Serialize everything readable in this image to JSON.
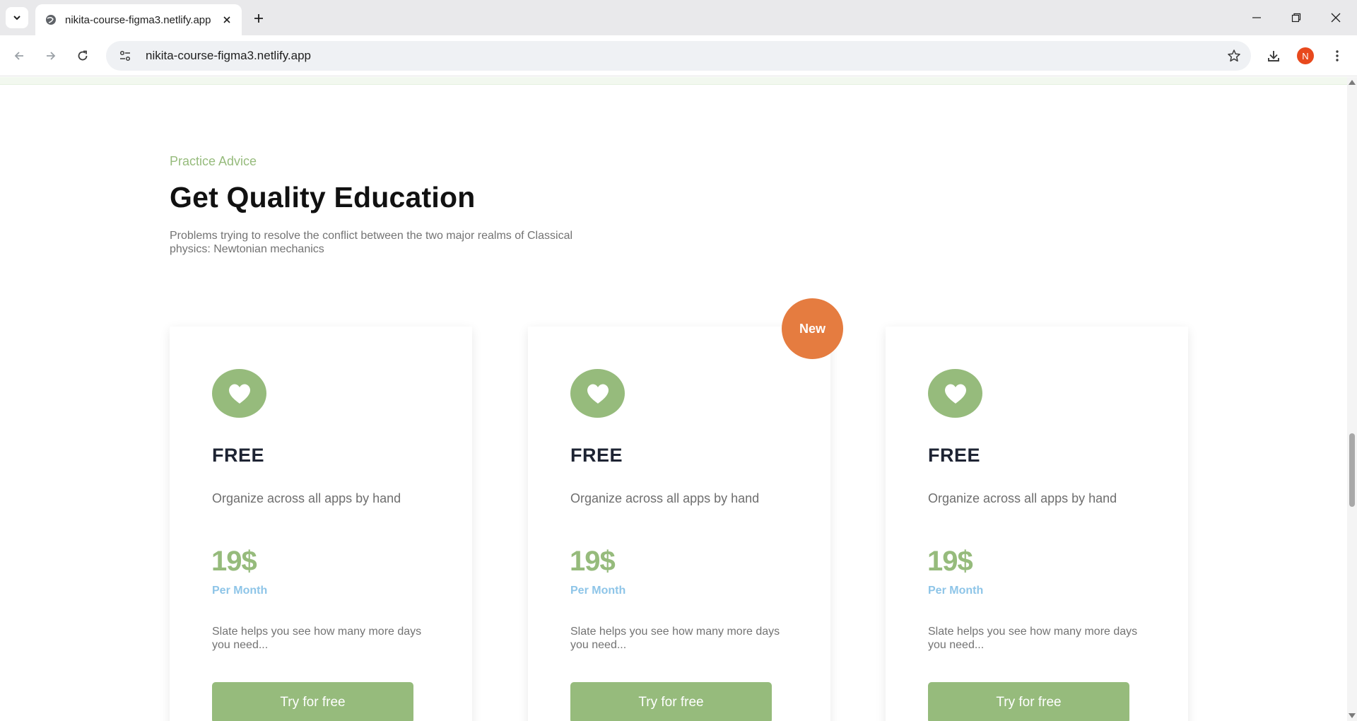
{
  "browser": {
    "tab_title": "nikita-course-figma3.netlify.app",
    "url": "nikita-course-figma3.netlify.app",
    "profile_initial": "N"
  },
  "section": {
    "eyebrow": "Practice Advice",
    "heading": "Get Quality Education",
    "subtext": "Problems trying to resolve the conflict between the two major realms of Classical physics: Newtonian mechanics"
  },
  "badge": "New",
  "cards": [
    {
      "plan": "FREE",
      "description": "Organize across all apps by hand",
      "price": "19$",
      "period": "Per Month",
      "note": "Slate helps you see how many more days you need...",
      "cta": "Try for free"
    },
    {
      "plan": "FREE",
      "description": "Organize across all apps by hand",
      "price": "19$",
      "period": "Per Month",
      "note": "Slate helps you see how many more days you need...",
      "cta": "Try for free"
    },
    {
      "plan": "FREE",
      "description": "Organize across all apps by hand",
      "price": "19$",
      "period": "Per Month",
      "note": "Slate helps you see how many more days you need...",
      "cta": "Try for free"
    }
  ],
  "colors": {
    "accent_green": "#96bb7c",
    "badge_orange": "#e57c40",
    "period_blue": "#8ec5e8",
    "heading": "#111111"
  },
  "icons": {
    "card_icon": "heart-icon"
  }
}
